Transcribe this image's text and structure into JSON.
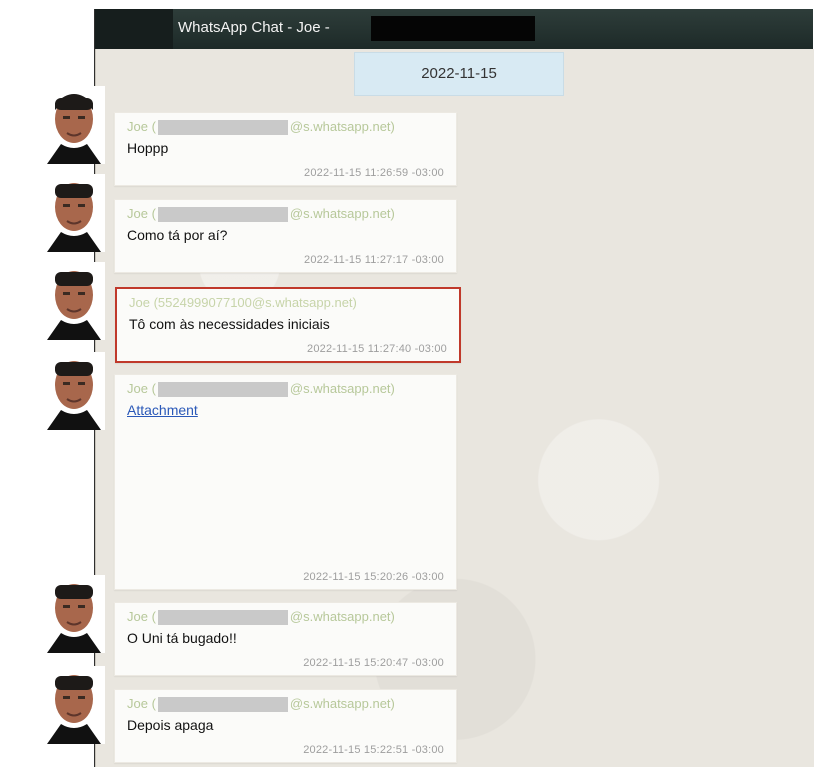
{
  "window": {
    "title": "WhatsApp Chat - Joe -"
  },
  "date_chip": "2022-11-15",
  "messages": [
    {
      "sender_prefix": "Joe (",
      "sender_suffix": "@s.whatsapp.net)",
      "text": "Hoppp",
      "timestamp": "2022-11-15 11:26:59 -03:00",
      "highlighted": false
    },
    {
      "sender_prefix": "Joe (",
      "sender_suffix": "@s.whatsapp.net)",
      "text": "Como tá por aí?",
      "timestamp": "2022-11-15 11:27:17 -03:00",
      "highlighted": false
    },
    {
      "sender_full": "Joe (5524999077100@s.whatsapp.net)",
      "text": "Tô com às necessidades iniciais",
      "timestamp": "2022-11-15 11:27:40 -03:00",
      "highlighted": true
    },
    {
      "sender_prefix": "Joe (",
      "sender_suffix": "@s.whatsapp.net)",
      "link": "Attachment",
      "timestamp": "2022-11-15 15:20:26 -03:00",
      "highlighted": false
    },
    {
      "sender_prefix": "Joe (",
      "sender_suffix": "@s.whatsapp.net)",
      "text": "O Uni tá bugado!!",
      "timestamp": "2022-11-15 15:20:47 -03:00",
      "highlighted": false
    },
    {
      "sender_prefix": "Joe (",
      "sender_suffix": "@s.whatsapp.net)",
      "text": "Depois apaga",
      "timestamp": "2022-11-15 15:22:51 -03:00",
      "highlighted": false
    }
  ],
  "colors": {
    "titlebar": "#1d2a28",
    "chat_bg": "#e9e6df",
    "bubble": "#fbfbf9",
    "sender": "#b7c89a",
    "highlight_border": "#c0392b",
    "link": "#2a58b8",
    "date_chip": "#d8eaf3"
  },
  "icons": {
    "avatar": "contact-avatar-photo"
  }
}
